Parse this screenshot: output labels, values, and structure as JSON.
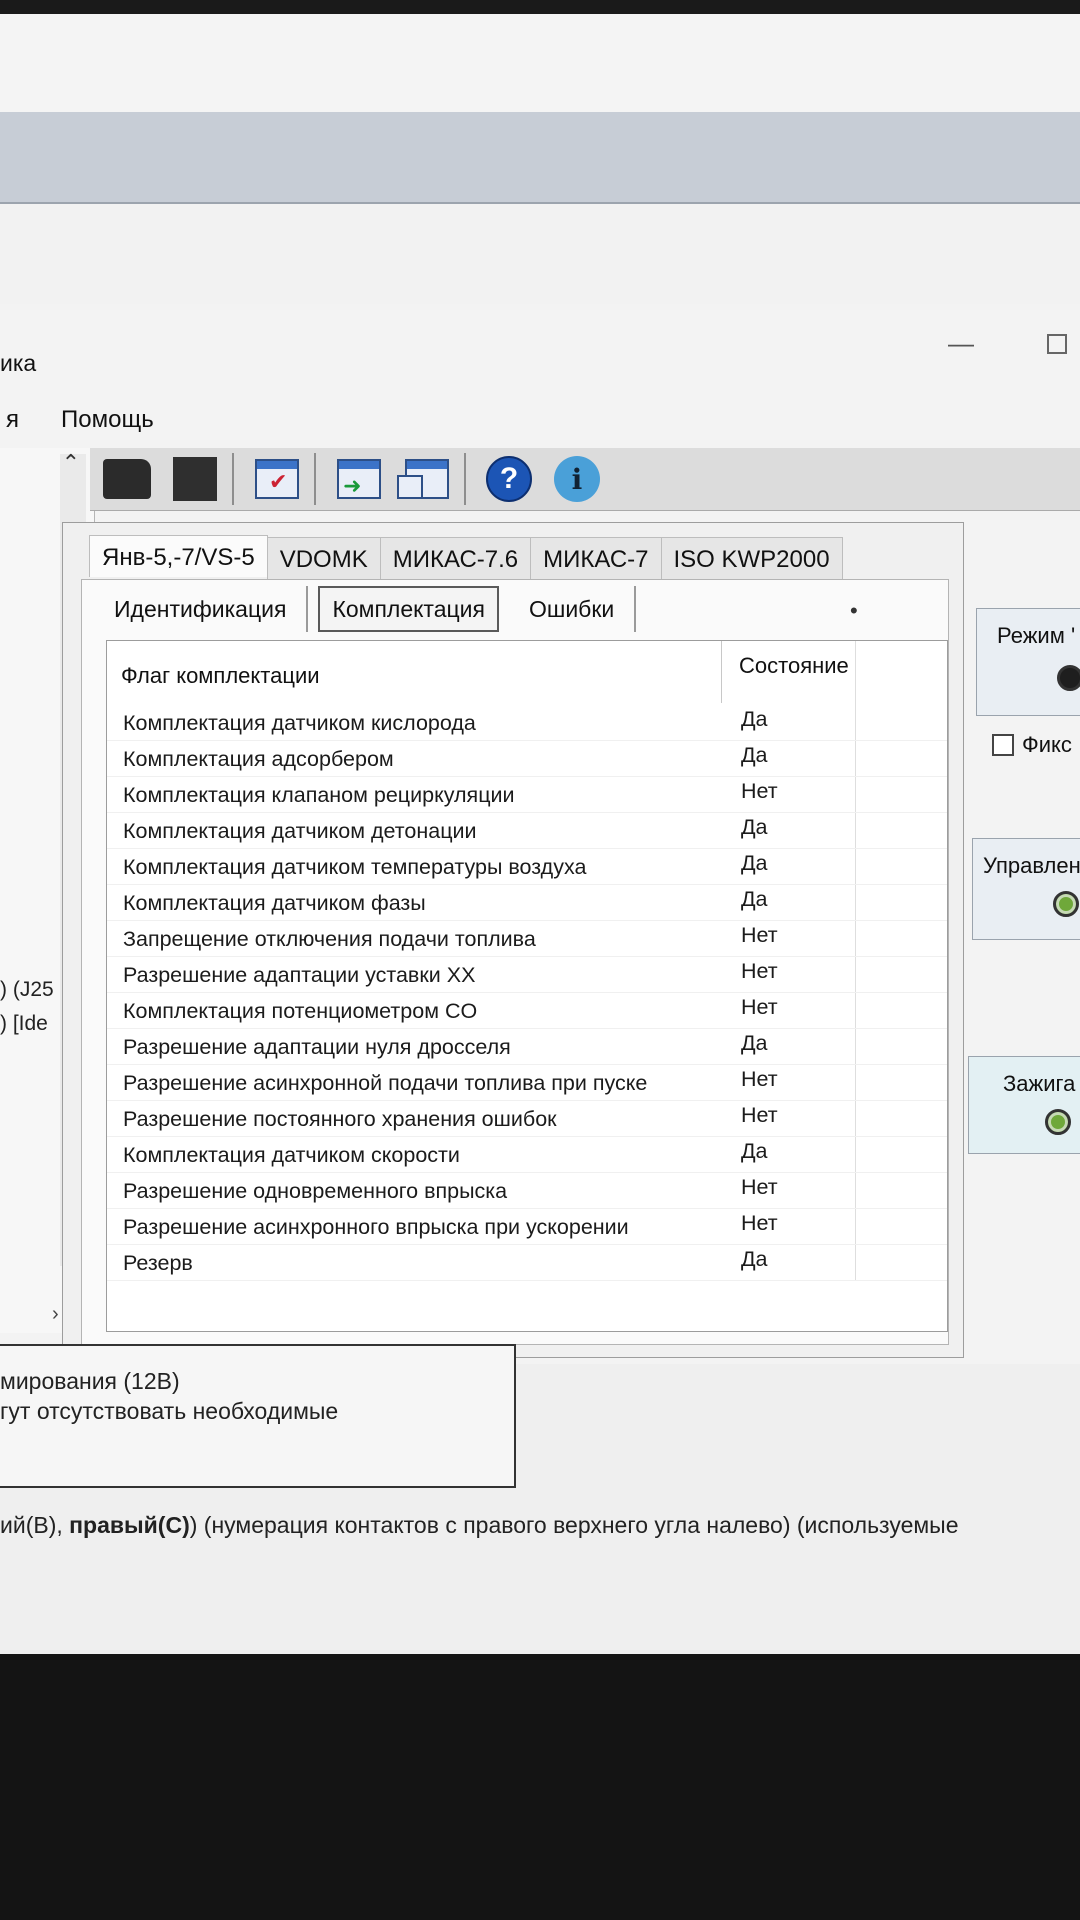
{
  "window": {
    "title": "ика",
    "minimize_icon": "minimize-icon",
    "maximize_icon": "maximize-icon"
  },
  "menu": {
    "items": [
      "я",
      "Помощь"
    ]
  },
  "toolbar": {
    "icons": [
      "open-folder-icon",
      "stop-icon",
      "settings-window-icon",
      "export-window-icon",
      "save-window-icon",
      "help-icon",
      "info-icon"
    ],
    "help_glyph": "?",
    "info_glyph": "i"
  },
  "tree": {
    "lines": [
      ") (J25",
      ") [Ide"
    ]
  },
  "protocol_tabs": [
    "Янв-5,-7/VS-5",
    "VDOMK",
    "МИКАС-7.6",
    "МИКАС-7",
    "ISO KWP2000"
  ],
  "sub_tabs": [
    "Идентификация",
    "Комплектация",
    "Ошибки"
  ],
  "sub_tab_dot": "•",
  "table": {
    "headers": {
      "flag": "Флаг комплектации",
      "state": "Состояние"
    },
    "rows": [
      {
        "flag": "Комплектация датчиком кислорода",
        "state": "Да"
      },
      {
        "flag": "Комплектация адсорбером",
        "state": "Да"
      },
      {
        "flag": "Комплектация клапаном рециркуляции",
        "state": "Нет"
      },
      {
        "flag": "Комплектация датчиком детонации",
        "state": "Да"
      },
      {
        "flag": "Комплектация датчиком температуры воздуха",
        "state": "Да"
      },
      {
        "flag": "Комплектация датчиком фазы",
        "state": "Да"
      },
      {
        "flag": "Запрещение отключения подачи топлива",
        "state": "Нет"
      },
      {
        "flag": "Разрешение адаптации уставки XX",
        "state": "Нет"
      },
      {
        "flag": "Комплектация потенциометром CO",
        "state": "Нет"
      },
      {
        "flag": "Разрешение адаптации нуля дросселя",
        "state": "Да"
      },
      {
        "flag": "Разрешение асинхронной подачи топлива при пуске",
        "state": "Нет"
      },
      {
        "flag": "Разрешение постоянного хранения ошибок",
        "state": "Нет"
      },
      {
        "flag": "Комплектация датчиком скорости",
        "state": "Да"
      },
      {
        "flag": "Разрешение одновременного впрыска",
        "state": "Нет"
      },
      {
        "flag": "Разрешение асинхронного впрыска при ускорении",
        "state": "Нет"
      },
      {
        "flag": "Резерв",
        "state": "Да"
      }
    ]
  },
  "right_panel": {
    "mode_label": "Режим '",
    "fix_label": "Фикс",
    "control_label": "Управлен",
    "ignition_label": "Зажига"
  },
  "document": {
    "table_lines": [
      "мирования (12В)",
      "гут отсутствовать необходимые"
    ],
    "bottom_prefix": "ий(В), ",
    "bottom_bold": "правый(С)",
    "bottom_suffix": ") (нумерация контактов с правого верхнего угла налево) (используемые"
  },
  "colors": {
    "led_green": "#6fa83a",
    "help_blue": "#1c55b5"
  }
}
